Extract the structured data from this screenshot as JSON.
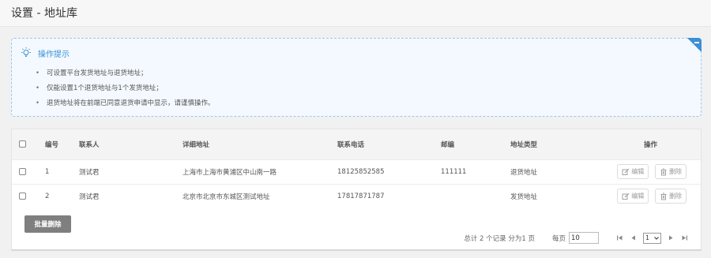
{
  "header": {
    "title": "设置 - 地址库"
  },
  "tips": {
    "title": "操作提示",
    "items": [
      "可设置平台发货地址与退货地址；",
      "仅能设置1个退货地址与1个发货地址；",
      "退货地址将在前端已同意退货申请中显示，请谨慎操作。"
    ]
  },
  "table": {
    "headers": {
      "id": "编号",
      "contact": "联系人",
      "address": "详细地址",
      "phone": "联系电话",
      "zip": "邮编",
      "type": "地址类型",
      "ops": "操作"
    },
    "rows": [
      {
        "id": "1",
        "contact": "测试君",
        "address": "上海市上海市黄浦区中山南一路",
        "phone": "18125852585",
        "zip": "111111",
        "type": "退货地址"
      },
      {
        "id": "2",
        "contact": "测试君",
        "address": "北京市北京市东城区测试地址",
        "phone": "17817871787",
        "zip": "",
        "type": "发货地址"
      }
    ],
    "edit_label": "编辑",
    "delete_label": "删除"
  },
  "bulk_delete_label": "批量删除",
  "pager": {
    "summary": "总计 2 个记录 分为1 页",
    "per_page_label": "每页",
    "per_page_value": "10",
    "current_page": "1"
  }
}
